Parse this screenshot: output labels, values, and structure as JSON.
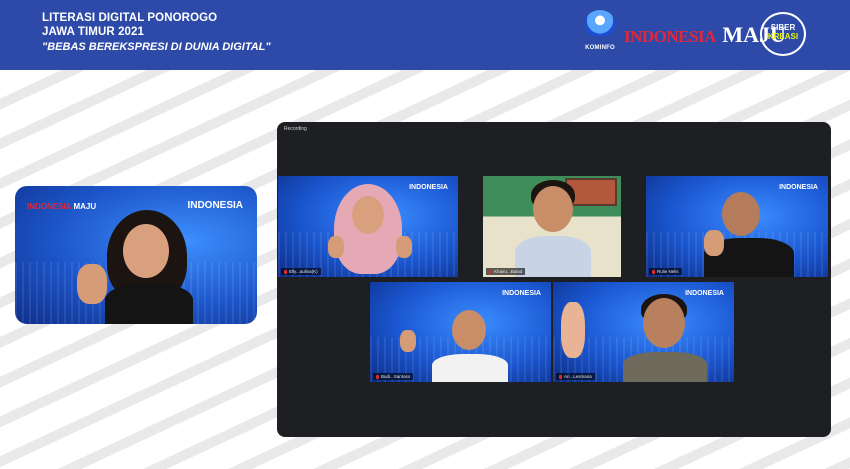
{
  "header": {
    "title_line1": "LITERASI DIGITAL PONOROGO",
    "title_line2": "JAWA TIMUR 2021",
    "tagline": "\"BEBAS BEREKSPRESI DI DUNIA DIGITAL\"",
    "background_color": "#2d4aa8",
    "logos": {
      "kominfo": "KOMINFO",
      "indonesia": "INDONESIA",
      "maju": "MAJU",
      "siber_top": "SIBER",
      "siber_bottom": "KREASI"
    }
  },
  "presenter": {
    "mini_logo_a": "INDONESIA",
    "mini_logo_b": "MAJU",
    "mini_indonesia": "INDONESIA"
  },
  "meeting": {
    "recording_label": "Recording",
    "participants": [
      {
        "name": "Elly...aulina(K)",
        "background": "blue",
        "indonesia": "INDONESIA"
      },
      {
        "name": "Khairu...Balad",
        "background": "room"
      },
      {
        "name": "Rulie Nelis",
        "background": "blue",
        "indonesia": "INDONESIA"
      },
      {
        "name": "Budi...Santoso",
        "background": "blue",
        "indonesia": "INDONESIA"
      },
      {
        "name": "Ari...Lesmana",
        "background": "blue",
        "indonesia": "INDONESIA"
      }
    ]
  }
}
